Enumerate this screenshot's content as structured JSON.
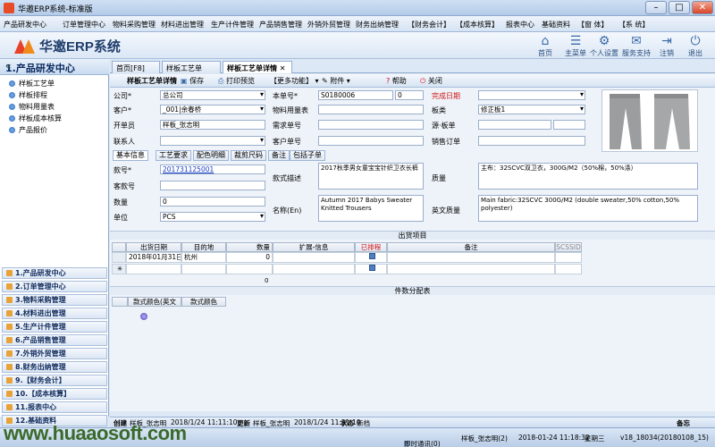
{
  "window": {
    "title": "华邀ERP系统-标准版",
    "min": "–",
    "max": "□",
    "close": "✕"
  },
  "menu": [
    "产品研发中心",
    "订单管理中心",
    "物料采购管理",
    "材料进出管理",
    "生产计件管理",
    "产品销售管理",
    "外销外贸管理",
    "财务出纳管理",
    "【财务会计】",
    "【成本核算】",
    "报表中心",
    "基础资料",
    "【窗 体】",
    "【系 统】"
  ],
  "app": {
    "name": "华邀ERP系统"
  },
  "tools": [
    {
      "label": "首页",
      "icon": "home-icon",
      "glyph": "⌂"
    },
    {
      "label": "主菜单",
      "icon": "menu-icon",
      "glyph": "☰"
    },
    {
      "label": "个人设置",
      "icon": "settings-icon",
      "glyph": "⚙"
    },
    {
      "label": "服务支持",
      "icon": "support-icon",
      "glyph": "✉"
    },
    {
      "label": "注销",
      "icon": "logout-icon",
      "glyph": "⇥"
    },
    {
      "label": "退出",
      "icon": "power-icon",
      "glyph": "⏻"
    }
  ],
  "left": {
    "title": "1.产品研发中心",
    "items": [
      "样板工艺单",
      "样板排程",
      "物料用量表",
      "样板成本核算",
      "产品报价"
    ],
    "nav": [
      "1.产品研发中心",
      "2.订单管理中心",
      "3.物料采购管理",
      "4.材料进出管理",
      "5.生产计件管理",
      "6.产品销售管理",
      "7.外销外贸管理",
      "8.财务出纳管理",
      "9.【财务会计】",
      "10.【成本核算】",
      "11.报表中心",
      "12.基础资料"
    ]
  },
  "tabs": [
    "首页[F8]",
    "样板工艺单",
    "样板工艺单详情"
  ],
  "toolbar": {
    "title": "样板工艺单详情",
    "save": "保存",
    "print": "打印预览",
    "more": "【更多功能】",
    "attach": "附件",
    "help": "帮助",
    "close": "关闭"
  },
  "form": {
    "company_label": "公司*",
    "company": "总公司",
    "customer_label": "客户*",
    "customer": "_001|余春桥",
    "creator_label": "开单员",
    "creator": "样板_张志明",
    "contact_label": "联系人",
    "contact": "",
    "doc_label": "本单号*",
    "doc_no": "S0180006",
    "doc_extra": "0",
    "material_label": "物料用量表",
    "material": "",
    "demand_label": "需求单号",
    "demand": "",
    "custorder_label": "客户单号",
    "custorder": "",
    "done_label": "完成日期",
    "done": "",
    "board_label": "板类",
    "board": "修正板1",
    "source_label": "源·板单",
    "source": "",
    "sales_label": "销售订单",
    "sales": ""
  },
  "subtabs": [
    "基本信息",
    "工艺要求",
    "配色明细",
    "裁剪尺码",
    "备注",
    "包括子单"
  ],
  "basic": {
    "style_label": "款号*",
    "style": "201731125001",
    "guest_label": "客款号",
    "guest": "",
    "qty_label": "数量",
    "qty": "0",
    "unit_label": "单位",
    "unit": "PCS",
    "desc_label": "款式描述",
    "desc": "2017秋季男女童宝宝针织卫衣长裤",
    "name_label": "名称(En)",
    "name_en": "Autumn 2017 Babys Sweater Knitted Trousers",
    "quality_label": "质量",
    "quality": "主布：32SCVC双卫衣，300G/M2（50%棉，50%涤）",
    "quality_en_label": "英文质量",
    "quality_en": "Main fabric:32SCVC 300G/M2 (double sweater,50% cotton,50% polyester)"
  },
  "ship": {
    "title": "出货项目",
    "headers": [
      "出货日期",
      "目的地",
      "数量",
      "扩展-信息",
      "已排程",
      "备注",
      "SCSSID"
    ],
    "rows": [
      [
        "2018年01月31日",
        "杭州",
        "0",
        "",
        "",
        "",
        ""
      ]
    ],
    "new_row": "✳",
    "sub_total": "0"
  },
  "pieces": {
    "title": "件数分配表",
    "headers": [
      "款式颜色(英文",
      "款式颜色"
    ]
  },
  "status": {
    "create_label": "创建",
    "create_user": "样板_张志明",
    "create_time": "2018/1/24 11:11:10",
    "update_label": "更新",
    "update_user": "样板_张志明",
    "update_time": "2018/1/24 11:11:10",
    "state_label": "状态",
    "state": "新档",
    "remark": "备忘"
  },
  "taskbar": {
    "watermark": "www.huaaosoft.com",
    "msg": "即时通讯(0)",
    "user": "样板_张志明(2)",
    "datetime": "2018-01-24 11:18:32",
    "weekday": "星期三",
    "version": "v18_18034(20180108_15)"
  }
}
